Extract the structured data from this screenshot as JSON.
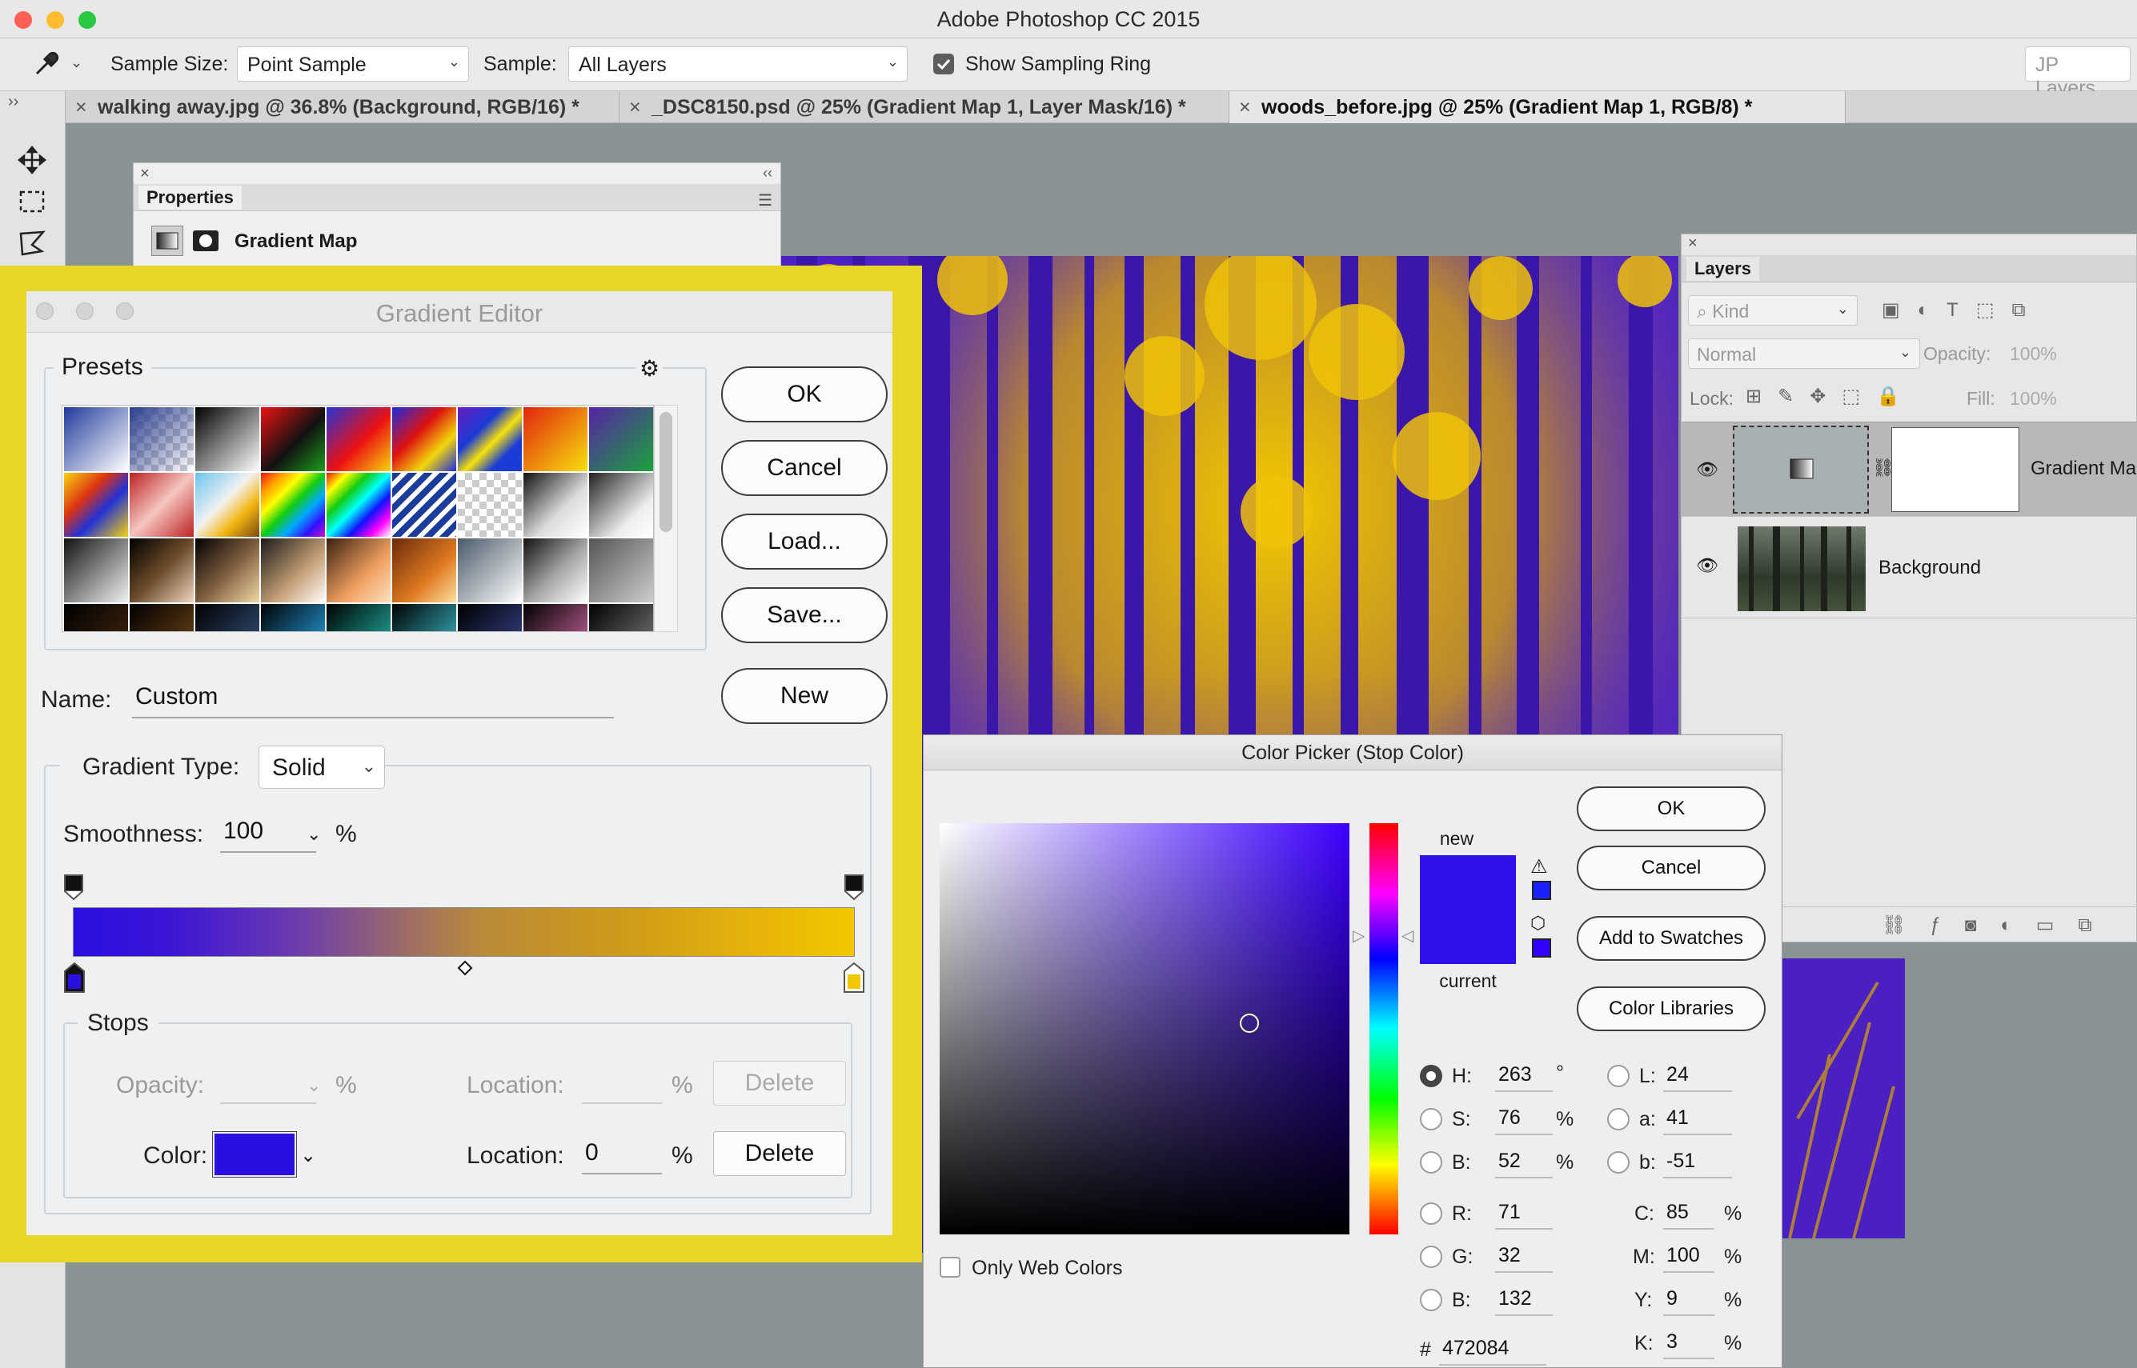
{
  "app": {
    "title": "Adobe Photoshop CC 2015"
  },
  "options": {
    "sample_size_label": "Sample Size:",
    "sample_size_value": "Point Sample",
    "sample_label": "Sample:",
    "sample_value": "All Layers",
    "show_ring_label": "Show Sampling Ring",
    "workspace": "JP Layers",
    "collapse_glyph": "››"
  },
  "tabs": [
    {
      "label": "walking away.jpg @ 36.8% (Background, RGB/16) *"
    },
    {
      "label": "_DSC8150.psd @ 25% (Gradient Map 1, Layer Mask/16) *"
    },
    {
      "label": "woods_before.jpg @ 25% (Gradient Map 1, RGB/8) *"
    }
  ],
  "properties": {
    "title": "Properties",
    "adjustment": "Gradient Map"
  },
  "layers": {
    "title": "Layers",
    "kind": "Kind",
    "blend": "Normal",
    "opacity_label": "Opacity:",
    "opacity_value": "100%",
    "lock_label": "Lock:",
    "fill_label": "Fill:",
    "fill_value": "100%",
    "items": [
      {
        "name": "Gradient Ma"
      },
      {
        "name": "Background"
      }
    ]
  },
  "gradient_editor": {
    "title": "Gradient Editor",
    "presets_label": "Presets",
    "buttons": {
      "ok": "OK",
      "cancel": "Cancel",
      "load": "Load...",
      "save": "Save...",
      "new": "New"
    },
    "name_label": "Name:",
    "name_value": "Custom",
    "type_label": "Gradient Type:",
    "type_value": "Solid",
    "smoothness_label": "Smoothness:",
    "smoothness_value": "100",
    "percent": "%",
    "stops_label": "Stops",
    "opacity_label": "Opacity:",
    "location_label": "Location:",
    "delete_label": "Delete",
    "color_label": "Color:",
    "color_location_value": "0",
    "stop_colors": {
      "left": "#2a10e0",
      "right": "#f3c700"
    }
  },
  "color_picker": {
    "title": "Color Picker (Stop Color)",
    "buttons": {
      "ok": "OK",
      "cancel": "Cancel",
      "add_swatches": "Add to Swatches",
      "libraries": "Color Libraries"
    },
    "new_label": "new",
    "current_label": "current",
    "web_only_label": "Only Web Colors",
    "new_color": "#2e10ea",
    "current_color": "#2e10ea",
    "hsb": [
      {
        "label": "H:",
        "value": "263",
        "unit": "°"
      },
      {
        "label": "S:",
        "value": "76",
        "unit": "%"
      },
      {
        "label": "B:",
        "value": "52",
        "unit": "%"
      }
    ],
    "rgb": [
      {
        "label": "R:",
        "value": "71"
      },
      {
        "label": "G:",
        "value": "32"
      },
      {
        "label": "B:",
        "value": "132"
      }
    ],
    "lab": [
      {
        "label": "L:",
        "value": "24"
      },
      {
        "label": "a:",
        "value": "41"
      },
      {
        "label": "b:",
        "value": "-51"
      }
    ],
    "cmyk": [
      {
        "label": "C:",
        "value": "85",
        "unit": "%"
      },
      {
        "label": "M:",
        "value": "100",
        "unit": "%"
      },
      {
        "label": "Y:",
        "value": "9",
        "unit": "%"
      },
      {
        "label": "K:",
        "value": "3",
        "unit": "%"
      }
    ],
    "hex_label": "#",
    "hex_value": "472084"
  }
}
